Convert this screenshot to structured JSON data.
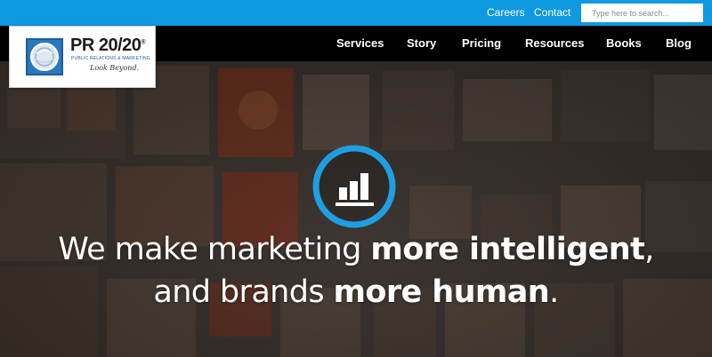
{
  "topbar": {
    "careers_label": "Careers",
    "contact_label": "Contact",
    "search_placeholder": "Type here to search..."
  },
  "logo": {
    "brand": "PR 20/20",
    "registered": "®",
    "tagline": "PUBLIC RELATIONS & MARKETING",
    "motto": "Look Beyond."
  },
  "nav": {
    "services": "Services",
    "story": "Story",
    "pricing": "Pricing",
    "resources": "Resources",
    "books": "Books",
    "blog": "Blog"
  },
  "hero": {
    "line1_regular": "We make marketing ",
    "line1_bold": "more intelligent",
    "line1_end": ",",
    "line2_regular": "and brands ",
    "line2_bold": "more human",
    "line2_end": ".",
    "icon": "bar-chart-icon"
  },
  "colors": {
    "topbar": "#0f99e0",
    "navbar": "#000000",
    "accent": "#1e9fe3"
  }
}
